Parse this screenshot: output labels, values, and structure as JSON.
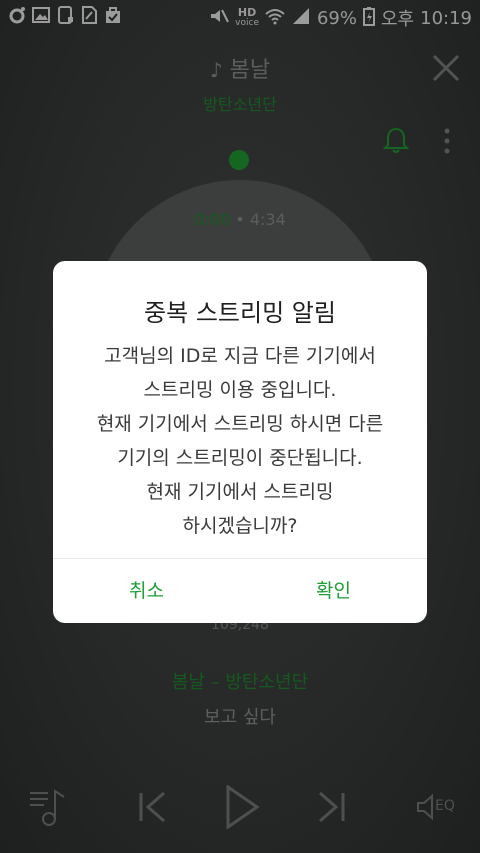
{
  "status_bar": {
    "hd_label": "HD",
    "voice_label": "voice",
    "battery": "69%",
    "ampm": "오후",
    "time": "10:19",
    "icons": [
      "app-circle-icon",
      "gallery-icon",
      "phone-icon",
      "file-icon",
      "bag-icon",
      "mute-icon",
      "wifi-icon",
      "signal-icon",
      "battery-icon"
    ]
  },
  "player": {
    "song_title": "봄날",
    "artist": "방탄소년단",
    "current_time": "0:00",
    "separator": "•",
    "total_time": "4:34",
    "play_count": "109,248",
    "song_artist_line": "봄날 – 방탄소년단",
    "lyric_line": "보고 싶다",
    "eq_label": "EQ",
    "accent_color": "#1e9e34"
  },
  "dialog": {
    "title": "중복 스트리밍 알림",
    "message_lines": [
      "고객님의 ID로 지금 다른 기기에서",
      "스트리밍 이용 중입니다.",
      "현재 기기에서 스트리밍 하시면 다른",
      "기기의 스트리밍이 중단됩니다.",
      "현재 기기에서 스트리밍",
      "하시겠습니까?"
    ],
    "cancel_label": "취소",
    "confirm_label": "확인"
  }
}
